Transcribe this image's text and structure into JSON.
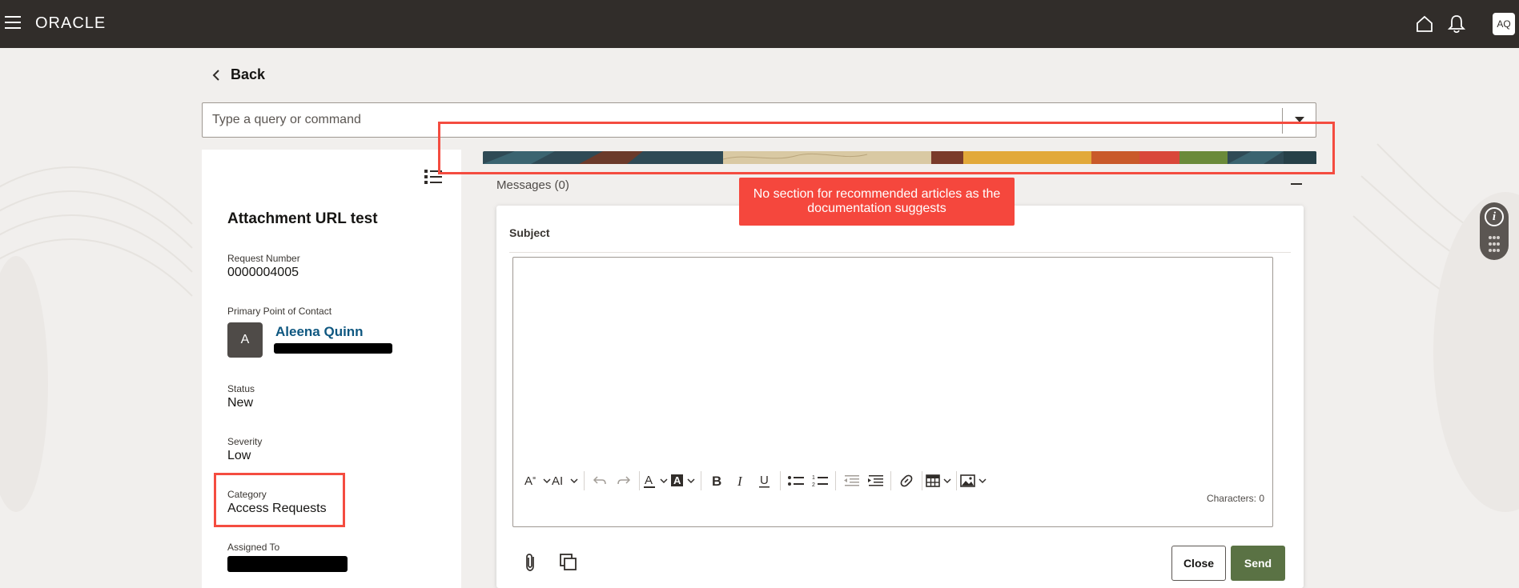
{
  "header": {
    "logo": "ORACLE",
    "user_initials": "AQ"
  },
  "nav": {
    "back_label": "Back"
  },
  "search": {
    "placeholder": "Type a query or command"
  },
  "request": {
    "title": "Attachment URL test",
    "fields": {
      "request_number_label": "Request Number",
      "request_number": "0000004005",
      "contact_label": "Primary Point of Contact",
      "contact_initial": "A",
      "contact_name": "Aleena Quinn",
      "status_label": "Status",
      "status": "New",
      "severity_label": "Severity",
      "severity": "Low",
      "category_label": "Category",
      "category": "Access Requests",
      "assigned_label": "Assigned To"
    }
  },
  "annotation": {
    "note": "No section for recommended articles as the documentation suggests",
    "color": "#f44c40"
  },
  "messages": {
    "header": "Messages (0)",
    "subject_label": "Subject",
    "characters": "Characters: 0",
    "close_label": "Close",
    "send_label": "Send"
  },
  "colors": {
    "topbar": "#312d2a",
    "send_button": "#5a7244",
    "link": "#0e5780"
  }
}
